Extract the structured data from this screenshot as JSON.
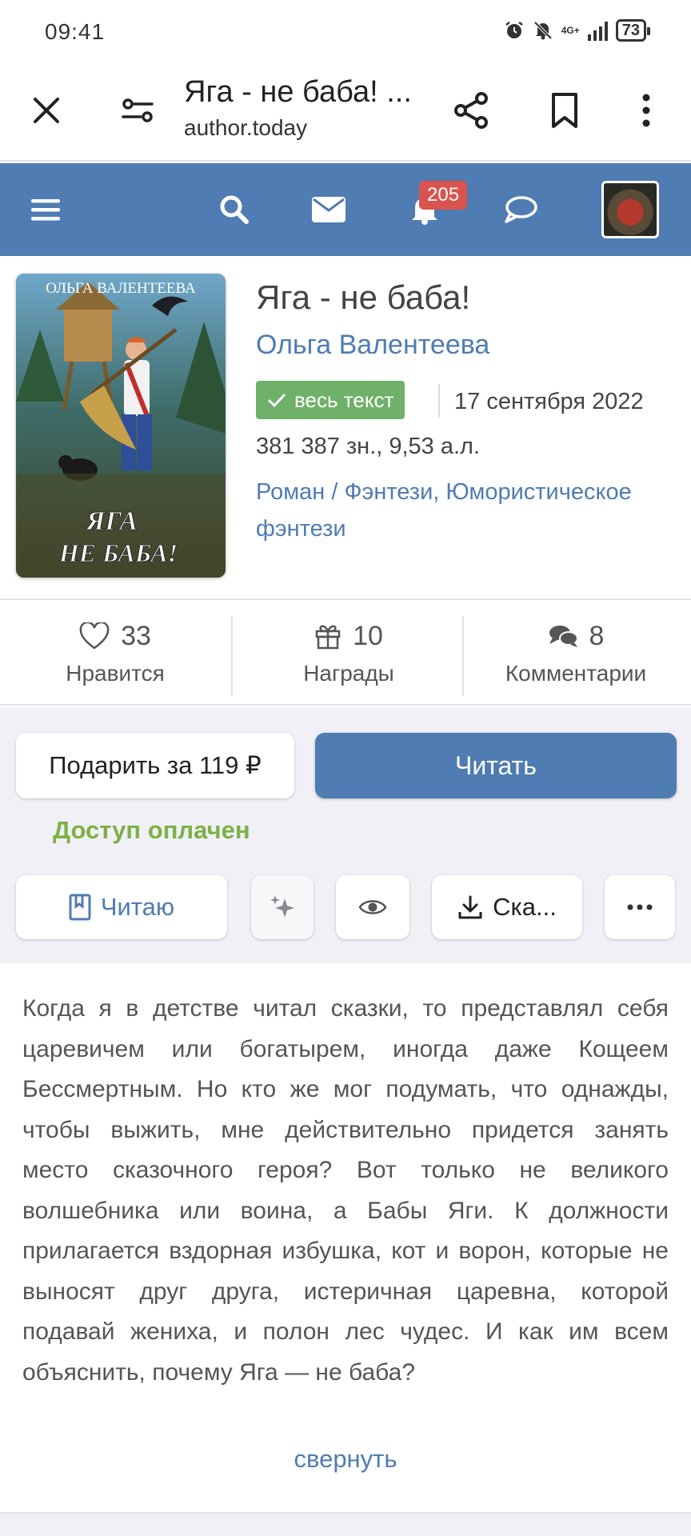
{
  "status_bar": {
    "time": "09:41",
    "network": "4G+",
    "battery": "73",
    "icons": [
      "alarm-icon",
      "mute-icon",
      "signal-icon",
      "battery-icon"
    ]
  },
  "browser": {
    "page_title": "Яга - не баба! ...",
    "url": "author.today",
    "icons": [
      "close-icon",
      "site-settings-icon",
      "share-icon",
      "bookmark-icon",
      "more-vertical-icon"
    ]
  },
  "site_header": {
    "notifications_count": "205",
    "icons": [
      "menu-icon",
      "search-icon",
      "mail-icon",
      "bell-icon",
      "chat-icon",
      "avatar"
    ],
    "colors": {
      "header_bg": "#4f7cb2",
      "badge": "#d9534f"
    }
  },
  "book": {
    "cover_text_author": "ОЛЬГА ВАЛЕНТЕЕВА",
    "cover_text_title_1": "ЯГА",
    "cover_text_title_2": "НЕ БАБА!",
    "title": "Яга - не баба!",
    "author": "Ольга Валентеева",
    "status_badge": "весь текст",
    "date": "17 сентября 2022",
    "size": "381 387 зн., 9,53 а.л.",
    "genre_1": "Роман",
    "genre_separator": "/",
    "genre_2": "Фэнтези,",
    "genre_3": "Юмористическое фэнтези"
  },
  "stats": {
    "likes": {
      "value": "33",
      "label": "Нравится"
    },
    "awards": {
      "value": "10",
      "label": "Награды"
    },
    "comments": {
      "value": "8",
      "label": "Комментарии"
    }
  },
  "actions": {
    "gift_label": "Подарить за 119 ₽",
    "read_label": "Читать",
    "access_status": "Доступ оплачен",
    "reading_label": "Читаю",
    "download_label": "Ска...",
    "colors": {
      "primary": "#4f7cb2",
      "access": "#7db146",
      "badge_green": "#6fb06a"
    }
  },
  "annotation": {
    "text": "Когда я в детстве читал сказки, то представлял себя царевичем или богатырем, иногда даже Ко­щеем Бессмертным. Но кто же мог подумать, что однажды, чтобы выжить, мне действительно при­дется занять место сказочного героя? Вот только не великого волшебника или воина, а Бабы Яги. К должности прилагается вздорная избушка, кот и ворон, которые не выносят друг друга, истеричная царевна, которой подавай жениха, и полон лес чу­дес. И как им всем объяснить, почему Яга — не баба?",
    "collapse_label": "свернуть"
  }
}
